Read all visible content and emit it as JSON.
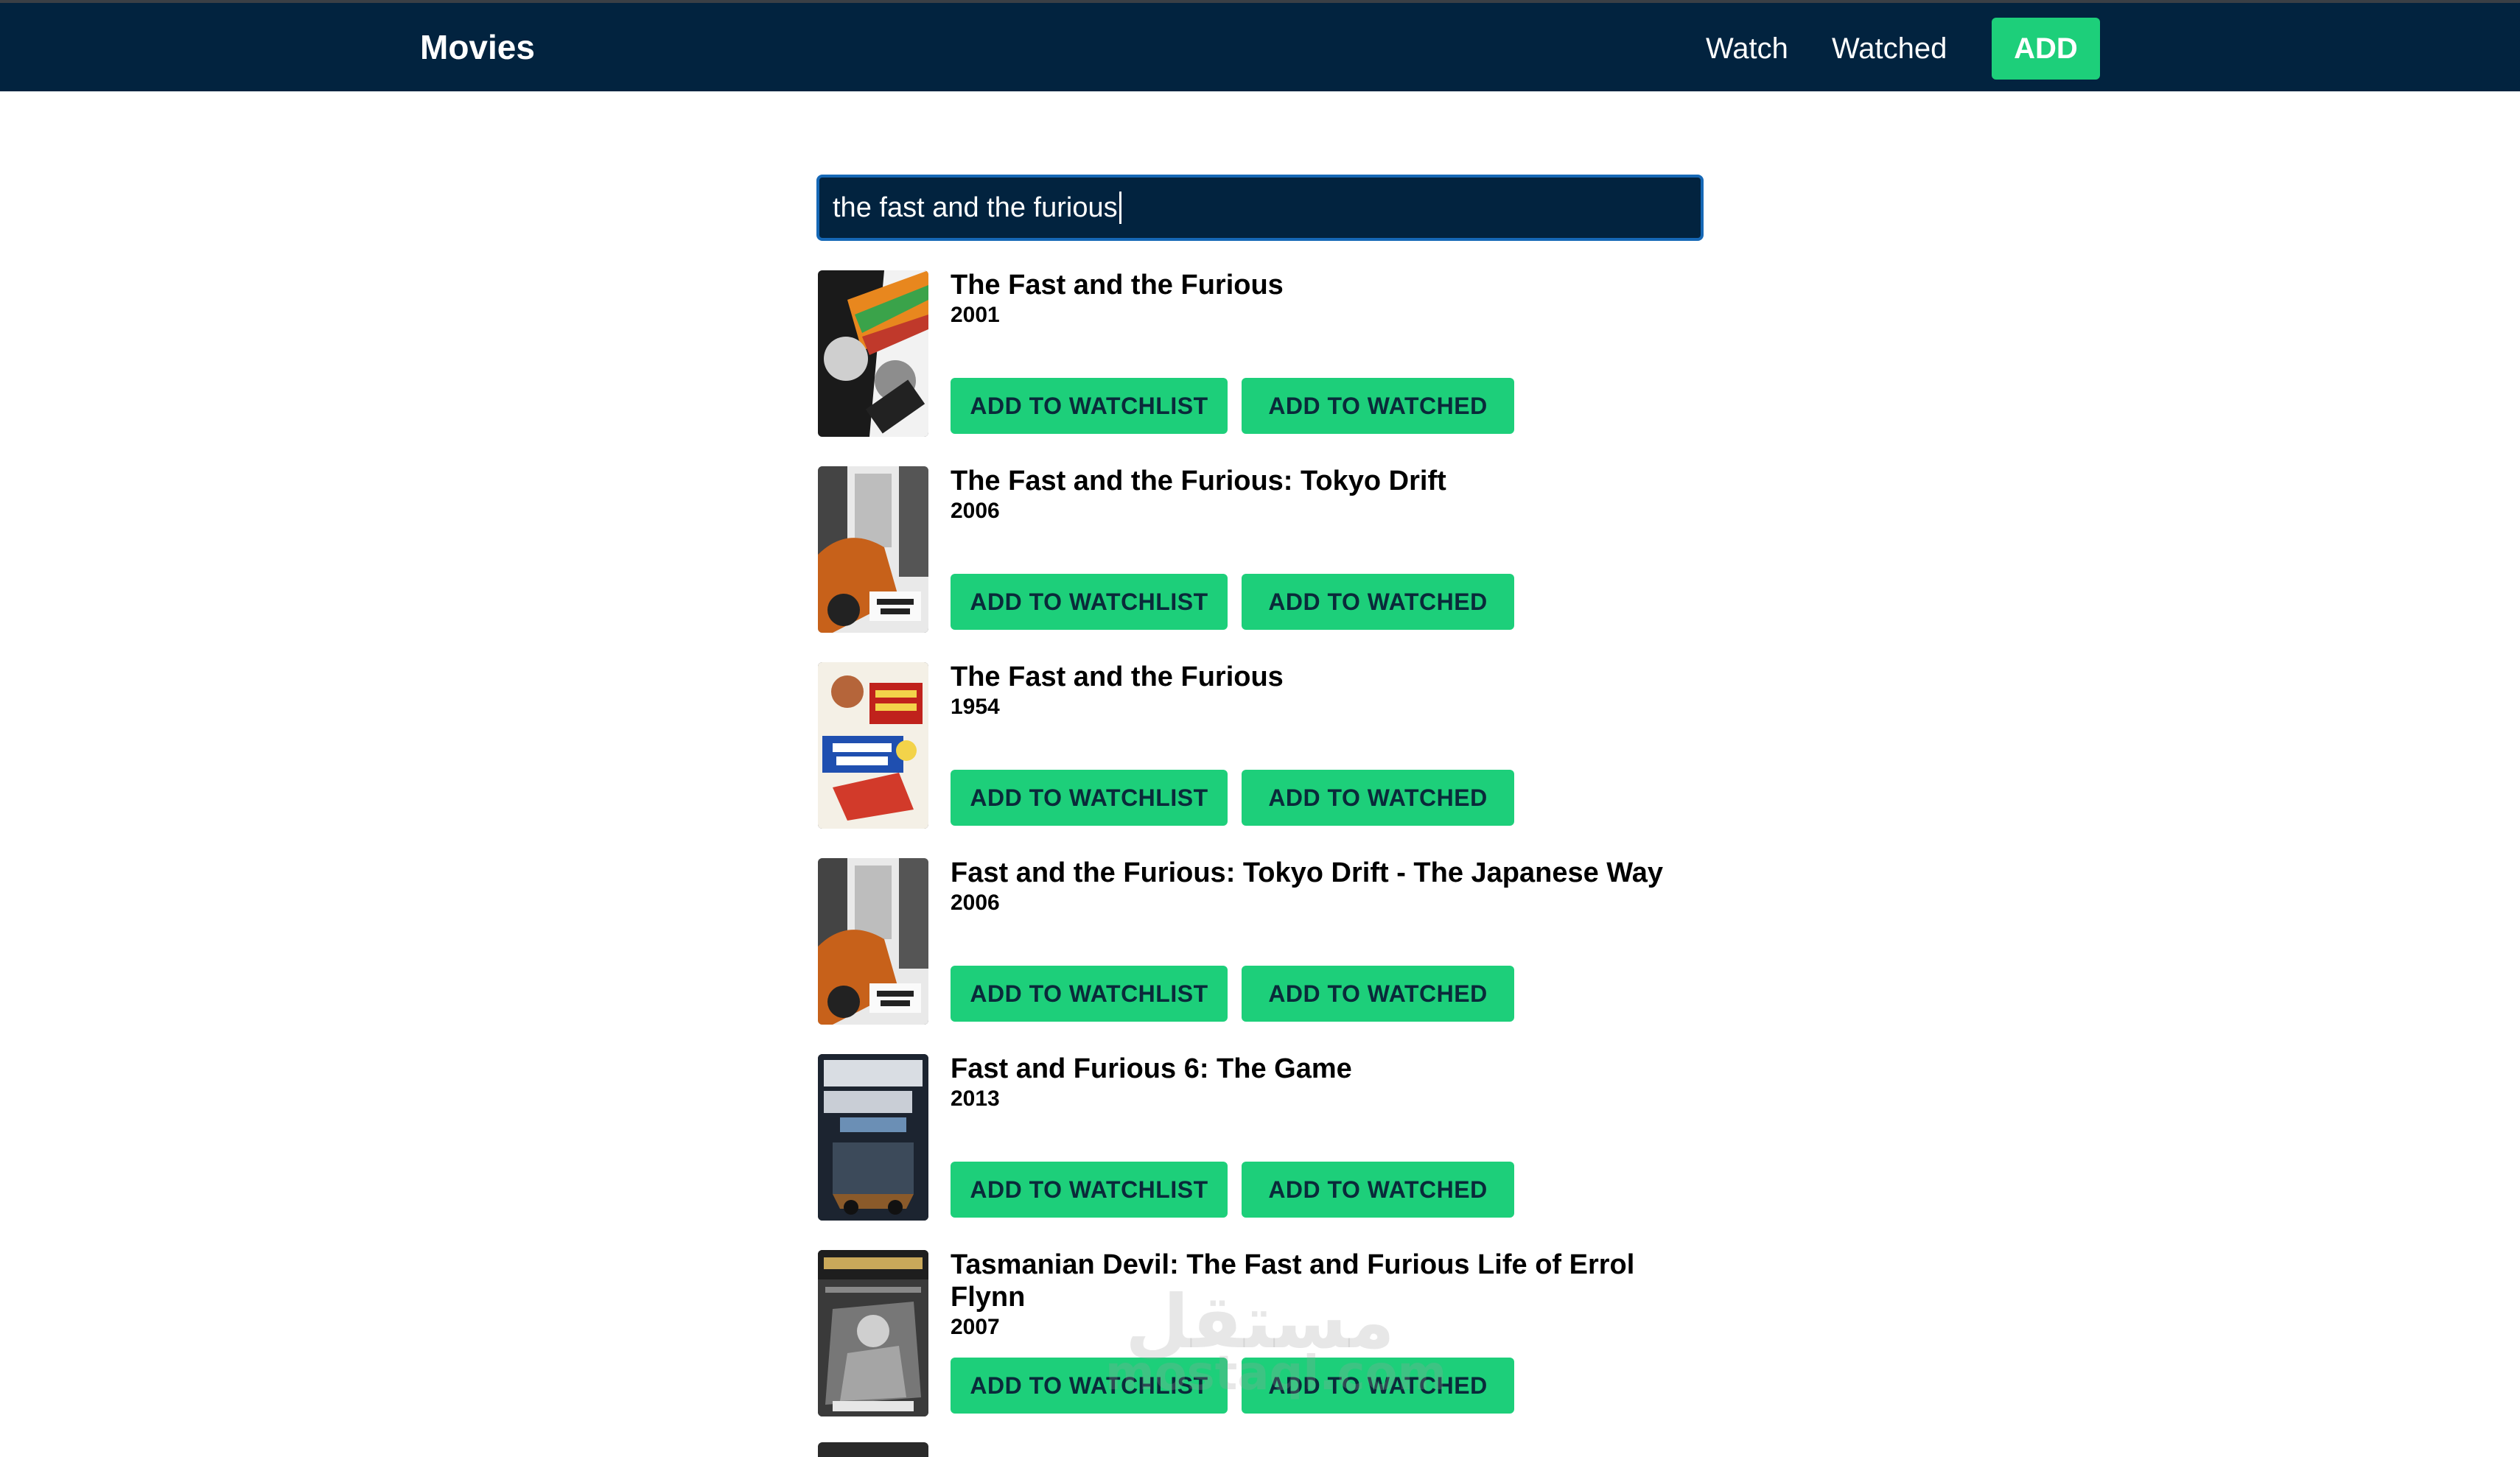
{
  "navbar": {
    "brand": "Movies",
    "links": [
      {
        "label": "Watch"
      },
      {
        "label": "Watched"
      }
    ],
    "add_label": "ADD"
  },
  "search": {
    "value": "the fast and the furious"
  },
  "results": [
    {
      "title": "The Fast and the Furious",
      "year": "2001"
    },
    {
      "title": "The Fast and the Furious: Tokyo Drift",
      "year": "2006"
    },
    {
      "title": "The Fast and the Furious",
      "year": "1954"
    },
    {
      "title": "Fast and the Furious: Tokyo Drift - The Japanese Way",
      "year": "2006"
    },
    {
      "title": "Fast and Furious 6: The Game",
      "year": "2013"
    },
    {
      "title": "Tasmanian Devil: The Fast and Furious Life of Errol Flynn",
      "year": "2007"
    }
  ],
  "buttons": {
    "watchlist_label": "ADD TO WATCHLIST",
    "watched_label": "ADD TO WATCHED"
  },
  "watermark": {
    "arabic": "مستقل",
    "latin": "mostaql.com"
  },
  "colors": {
    "navbar": "#02233f",
    "accent": "#1dcf7a",
    "search_border": "#1668b6"
  }
}
